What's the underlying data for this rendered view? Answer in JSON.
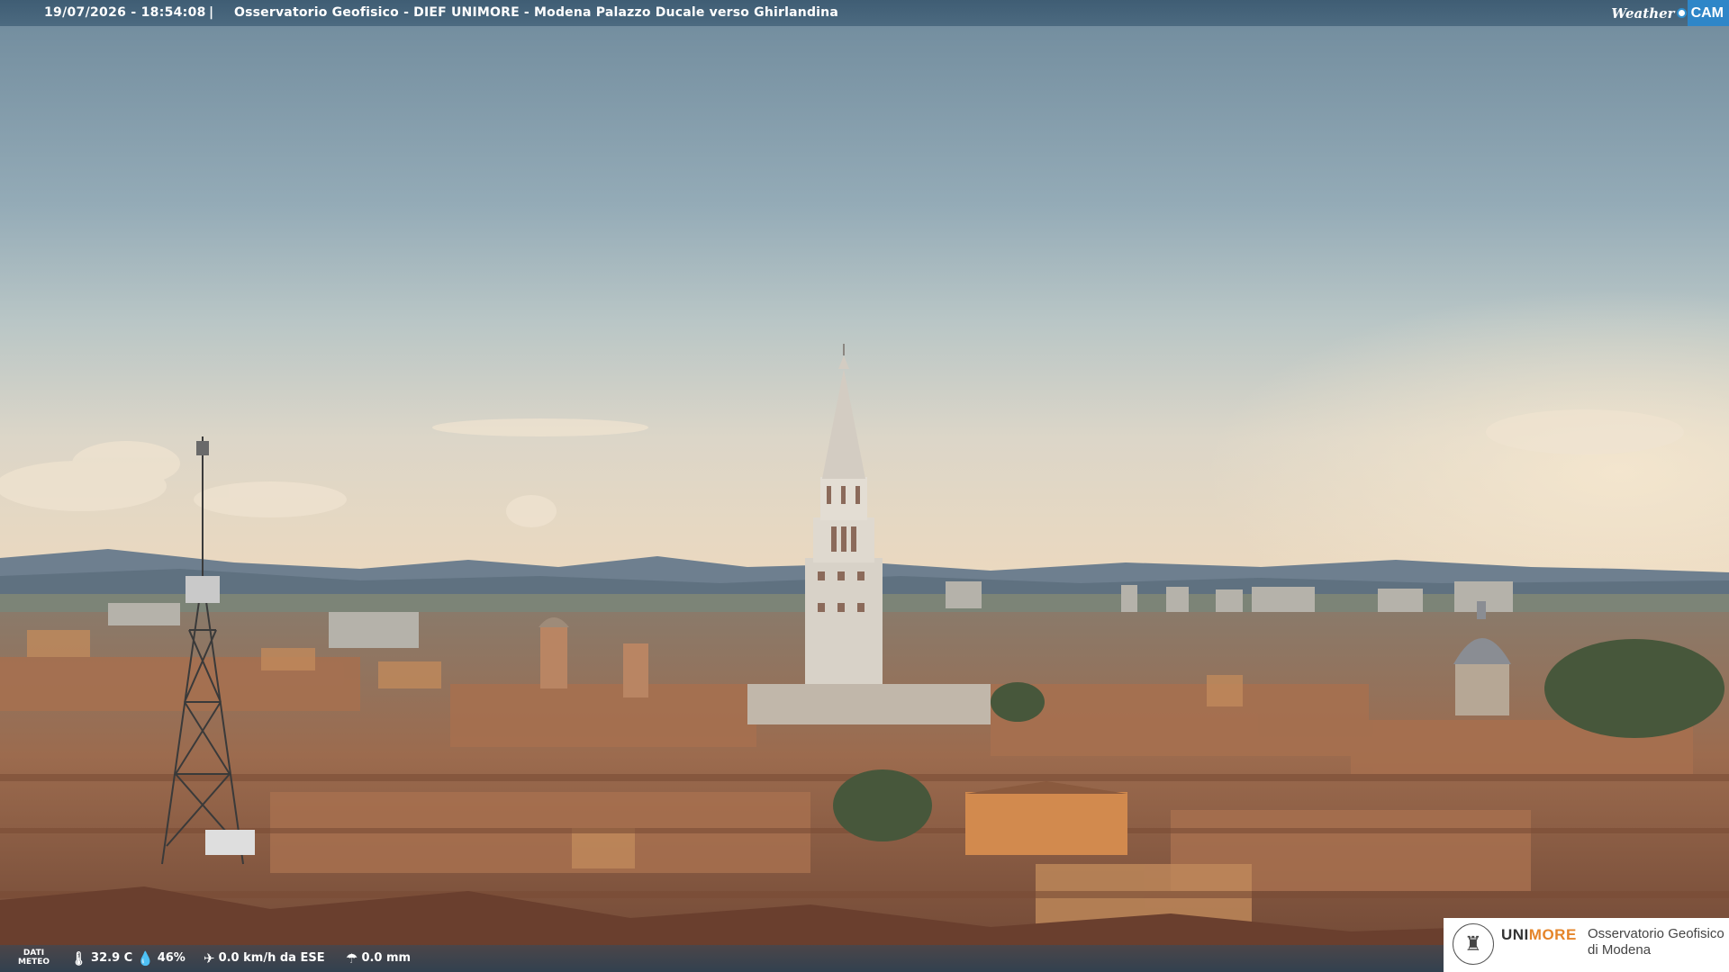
{
  "header": {
    "timestamp": "19/07/2026 - 18:54:08",
    "separator": "|",
    "title": "Osservatorio Geofisico - DIEF UNIMORE - Modena Palazzo Ducale verso Ghirlandina",
    "logo_weather": "Weather",
    "logo_cam": "CAM"
  },
  "weather": {
    "dati_label_1": "DATI",
    "dati_label_2": "METEO",
    "temperature": "32.9 C",
    "humidity": "46%",
    "wind": "0.0 km/h da ESE",
    "rain": "0.0 mm",
    "icons": [
      "thermometer-icon",
      "humidity-icon",
      "wind-icon",
      "rain-icon"
    ]
  },
  "brand": {
    "uni_1": "UNI",
    "uni_2": "MORE",
    "observatory_line1": "Osservatorio Geofisico",
    "observatory_line2": "di Modena",
    "accent_color": "#e5852a"
  },
  "colors": {
    "sky_top": "#7c95a5",
    "sky_mid": "#aebfc3",
    "sky_horizon": "#e6d6c0",
    "roof": "#9b6a4c",
    "tower": "#d9d4cc"
  }
}
